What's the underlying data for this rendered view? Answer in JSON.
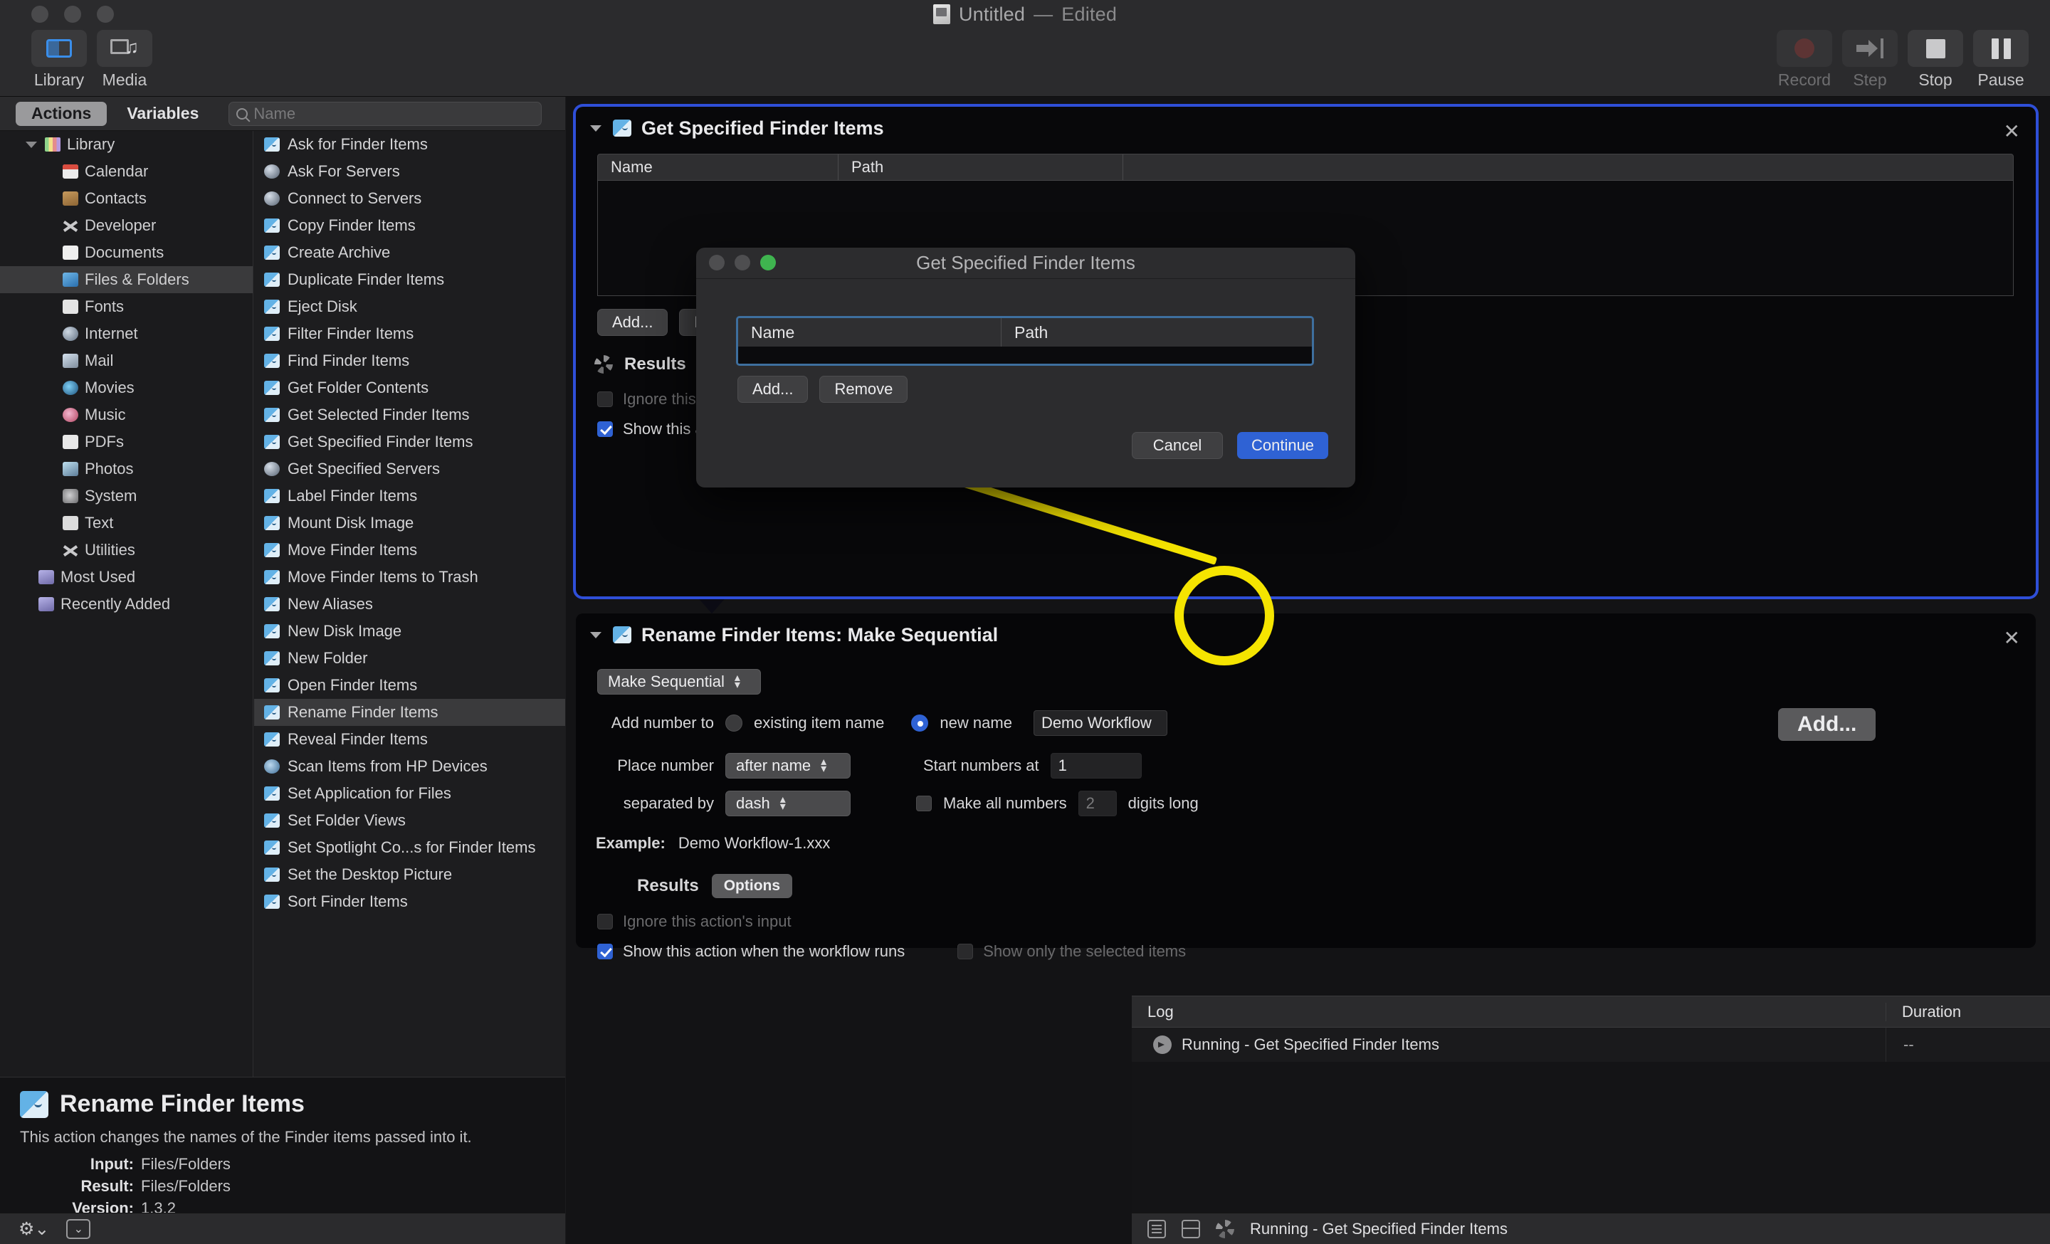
{
  "window": {
    "title": "Untitled",
    "separator": "—",
    "state": "Edited",
    "doc_icon": "automator-document-icon"
  },
  "toolbar": {
    "left": [
      {
        "label": "Library",
        "icon": "library-panel-icon",
        "active": true
      },
      {
        "label": "Media",
        "icon": "media-panel-icon",
        "active": false
      }
    ],
    "right": [
      {
        "label": "Record",
        "icon": "record-icon",
        "enabled": false
      },
      {
        "label": "Step",
        "icon": "step-icon",
        "enabled": false
      },
      {
        "label": "Stop",
        "icon": "stop-icon",
        "enabled": true
      },
      {
        "label": "Pause",
        "icon": "pause-icon",
        "enabled": true
      }
    ]
  },
  "sidebar": {
    "tabs": [
      {
        "label": "Actions",
        "active": true
      },
      {
        "label": "Variables",
        "active": false
      }
    ],
    "search": {
      "placeholder": "Name",
      "value": "",
      "icon": "search-icon"
    },
    "library": [
      {
        "label": "Library",
        "icon": "books-icon",
        "level": 0,
        "expanded": true,
        "selected": false
      },
      {
        "label": "Calendar",
        "icon": "calendar-icon",
        "level": 1,
        "selected": false
      },
      {
        "label": "Contacts",
        "icon": "contacts-icon",
        "level": 1,
        "selected": false
      },
      {
        "label": "Developer",
        "icon": "developer-icon",
        "level": 1,
        "selected": false
      },
      {
        "label": "Documents",
        "icon": "documents-icon",
        "level": 1,
        "selected": false
      },
      {
        "label": "Files & Folders",
        "icon": "files-folders-icon",
        "level": 1,
        "selected": true
      },
      {
        "label": "Fonts",
        "icon": "fonts-icon",
        "level": 1,
        "selected": false
      },
      {
        "label": "Internet",
        "icon": "internet-icon",
        "level": 1,
        "selected": false
      },
      {
        "label": "Mail",
        "icon": "mail-icon",
        "level": 1,
        "selected": false
      },
      {
        "label": "Movies",
        "icon": "movies-icon",
        "level": 1,
        "selected": false
      },
      {
        "label": "Music",
        "icon": "music-icon",
        "level": 1,
        "selected": false
      },
      {
        "label": "PDFs",
        "icon": "pdfs-icon",
        "level": 1,
        "selected": false
      },
      {
        "label": "Photos",
        "icon": "photos-icon",
        "level": 1,
        "selected": false
      },
      {
        "label": "System",
        "icon": "system-icon",
        "level": 1,
        "selected": false
      },
      {
        "label": "Text",
        "icon": "text-icon",
        "level": 1,
        "selected": false
      },
      {
        "label": "Utilities",
        "icon": "utilities-icon",
        "level": 1,
        "selected": false
      },
      {
        "label": "Most Used",
        "icon": "smart-folder-icon",
        "level": 0,
        "selected": false
      },
      {
        "label": "Recently Added",
        "icon": "smart-folder-icon",
        "level": 0,
        "selected": false
      }
    ],
    "actions": [
      {
        "label": "Ask for Finder Items",
        "icon": "finder-icon",
        "selected": false
      },
      {
        "label": "Ask For Servers",
        "icon": "globe-icon",
        "selected": false
      },
      {
        "label": "Connect to Servers",
        "icon": "globe-icon",
        "selected": false
      },
      {
        "label": "Copy Finder Items",
        "icon": "finder-icon",
        "selected": false
      },
      {
        "label": "Create Archive",
        "icon": "finder-icon",
        "selected": false
      },
      {
        "label": "Duplicate Finder Items",
        "icon": "finder-icon",
        "selected": false
      },
      {
        "label": "Eject Disk",
        "icon": "finder-icon",
        "selected": false
      },
      {
        "label": "Filter Finder Items",
        "icon": "finder-icon",
        "selected": false
      },
      {
        "label": "Find Finder Items",
        "icon": "finder-icon",
        "selected": false
      },
      {
        "label": "Get Folder Contents",
        "icon": "finder-icon",
        "selected": false
      },
      {
        "label": "Get Selected Finder Items",
        "icon": "finder-icon",
        "selected": false
      },
      {
        "label": "Get Specified Finder Items",
        "icon": "finder-icon",
        "selected": false
      },
      {
        "label": "Get Specified Servers",
        "icon": "globe-icon",
        "selected": false
      },
      {
        "label": "Label Finder Items",
        "icon": "finder-icon",
        "selected": false
      },
      {
        "label": "Mount Disk Image",
        "icon": "finder-icon",
        "selected": false
      },
      {
        "label": "Move Finder Items",
        "icon": "finder-icon",
        "selected": false
      },
      {
        "label": "Move Finder Items to Trash",
        "icon": "finder-icon",
        "selected": false
      },
      {
        "label": "New Aliases",
        "icon": "finder-icon",
        "selected": false
      },
      {
        "label": "New Disk Image",
        "icon": "finder-icon",
        "selected": false
      },
      {
        "label": "New Folder",
        "icon": "finder-icon",
        "selected": false
      },
      {
        "label": "Open Finder Items",
        "icon": "finder-icon",
        "selected": false
      },
      {
        "label": "Rename Finder Items",
        "icon": "finder-icon",
        "selected": true
      },
      {
        "label": "Reveal Finder Items",
        "icon": "finder-icon",
        "selected": false
      },
      {
        "label": "Scan Items from HP Devices",
        "icon": "scanner-icon",
        "selected": false
      },
      {
        "label": "Set Application for Files",
        "icon": "finder-icon",
        "selected": false
      },
      {
        "label": "Set Folder Views",
        "icon": "finder-icon",
        "selected": false
      },
      {
        "label": "Set Spotlight Co...s for Finder Items",
        "icon": "finder-icon",
        "selected": false
      },
      {
        "label": "Set the Desktop Picture",
        "icon": "finder-icon",
        "selected": false
      },
      {
        "label": "Sort Finder Items",
        "icon": "finder-icon",
        "selected": false
      }
    ],
    "description": {
      "title": "Rename Finder Items",
      "icon": "finder-icon",
      "summary": "This action changes the names of the Finder items passed into it.",
      "input_key": "Input:",
      "input_value": "Files/Folders",
      "result_key": "Result:",
      "result_value": "Files/Folders",
      "version_key": "Version:",
      "version_value": "1.3.2"
    },
    "status_bar": {
      "gear_icon": "gear-menu-icon",
      "disclosure_icon": "disclosure-icon"
    }
  },
  "workflow": {
    "actions": [
      {
        "title": "Get Specified Finder Items",
        "icon": "finder-icon",
        "close_icon": "close-icon",
        "disclosure_icon": "disclosure-triangle-icon",
        "table": {
          "columns": [
            "Name",
            "Path"
          ],
          "rows": []
        },
        "buttons": [
          {
            "label": "Add...",
            "name": "add-button"
          },
          {
            "label": "Remove",
            "name": "remove-button"
          }
        ],
        "results_label": "Results",
        "results_icon": "progress-spinner-icon",
        "checkboxes": [
          {
            "label": "Ignore this action's input",
            "checked": false,
            "enabled": false
          },
          {
            "label": "Show this action when the workflow runs",
            "checked": true,
            "enabled": true
          }
        ]
      },
      {
        "title": "Rename Finder Items: Make Sequential",
        "icon": "finder-icon",
        "close_icon": "close-icon",
        "disclosure_icon": "disclosure-triangle-icon",
        "mode_popup": {
          "value": "Make Sequential",
          "name": "rename-mode-popup"
        },
        "add_number_to_label": "Add number to",
        "radios": [
          {
            "label": "existing item name",
            "selected": false
          },
          {
            "label": "new name",
            "selected": true
          }
        ],
        "new_name_field": {
          "value": "Demo Workflow",
          "name": "new-name-field"
        },
        "add_button": {
          "label": "Add...",
          "name": "add-button-highlighted"
        },
        "place_number_label": "Place number",
        "place_number_popup": {
          "value": "after name"
        },
        "start_numbers_label": "Start numbers at",
        "start_numbers_value": "1",
        "separated_by_label": "separated by",
        "separated_by_popup": {
          "value": "dash"
        },
        "make_all_numbers_label": "Make all numbers",
        "make_all_numbers_checked": false,
        "digits_value": "2",
        "digits_long_label": "digits long",
        "example_label": "Example:",
        "example_value": "Demo Workflow-1.xxx",
        "results_label": "Results",
        "options_button": "Options",
        "checkboxes": [
          {
            "label": "Ignore this action's input",
            "checked": false,
            "enabled": false
          },
          {
            "label": "Show this action when the workflow runs",
            "checked": true,
            "enabled": true
          },
          {
            "label": "Show only the selected items",
            "checked": false,
            "enabled": false
          }
        ]
      }
    ]
  },
  "sheet": {
    "title": "Get Specified Finder Items",
    "traffic_lights": [
      "close-icon",
      "minimize-icon",
      "zoom-icon"
    ],
    "table": {
      "columns": [
        "Name",
        "Path"
      ],
      "rows": []
    },
    "list_buttons": [
      {
        "label": "Add...",
        "name": "sheet-add-button"
      },
      {
        "label": "Remove",
        "name": "sheet-remove-button"
      }
    ],
    "footer_buttons": [
      {
        "label": "Cancel",
        "name": "cancel-button",
        "primary": false
      },
      {
        "label": "Continue",
        "name": "continue-button",
        "primary": true
      }
    ]
  },
  "log": {
    "columns": [
      "Log",
      "Duration"
    ],
    "rows": [
      {
        "message": "Running - Get Specified Finder Items",
        "icon": "running-arrow-icon",
        "duration": "--"
      }
    ]
  },
  "status_bar": {
    "log_icon": "show-log-icon",
    "split_icon": "show-variables-icon",
    "spinner_icon": "progress-spinner-icon",
    "text": "Running - Get Specified Finder Items"
  },
  "annotation": {
    "color": "#f5e400",
    "target": "add-button-highlighted",
    "source": "sheet-add-button"
  },
  "colors": {
    "accent_blue": "#2f62d4",
    "focus_ring": "#2f4fd8",
    "highlight_yellow": "#f5e400",
    "window_bg": "#1c1c1e",
    "panel_bg": "#050506"
  }
}
